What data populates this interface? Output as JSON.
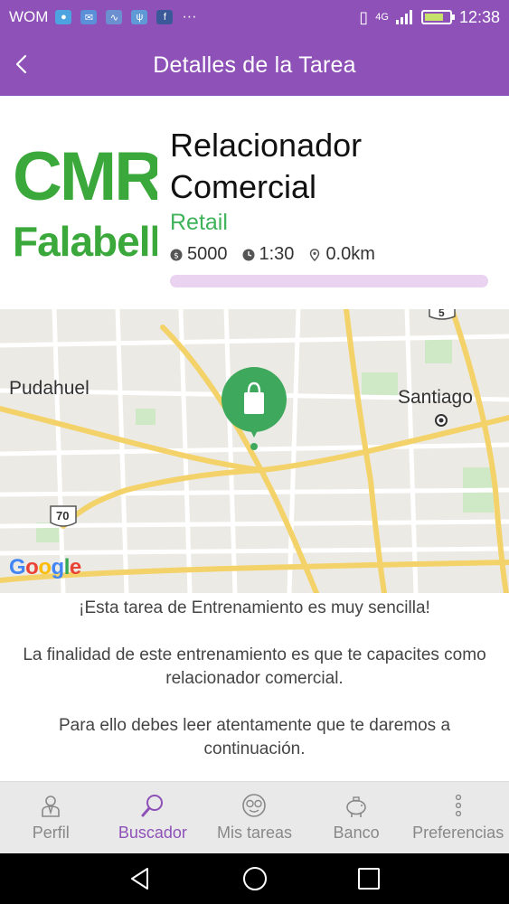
{
  "status_bar": {
    "carrier": "WOM",
    "network": "4G",
    "time": "12:38",
    "battery_level": 0.7
  },
  "header": {
    "title": "Detalles de la Tarea"
  },
  "task": {
    "logo_text_top": "CMR",
    "logo_text_bottom": "Falabella",
    "title": "Relacionador Comercial",
    "category": "Retail",
    "reward": "5000",
    "duration": "1:30",
    "distance": "0.0km",
    "progress": 0
  },
  "map": {
    "label_pudahuel": "Pudahuel",
    "label_santiago": "Santiago",
    "route_70": "70",
    "route_5": "5",
    "google_letters": [
      "G",
      "o",
      "o",
      "g",
      "l",
      "e"
    ],
    "marker_icon": "shopping-bag-icon"
  },
  "description": {
    "p1": "¡Esta tarea de Entrenamiento es muy sencilla!",
    "p2": "La finalidad de este entrenamiento es que te capacites como relacionador comercial.",
    "p3": "Para ello debes leer atentamente que te daremos a continuación."
  },
  "tabs": [
    {
      "label": "Perfil",
      "icon": "profile-icon"
    },
    {
      "label": "Buscador",
      "icon": "search-icon",
      "active": true
    },
    {
      "label": "Mis tareas",
      "icon": "tasks-icon"
    },
    {
      "label": "Banco",
      "icon": "piggy-bank-icon"
    },
    {
      "label": "Preferencias",
      "icon": "more-vertical-icon"
    }
  ],
  "colors": {
    "brand_purple": "#8E51B8",
    "accent_green": "#3fb35a",
    "progress_track": "#e9d3f1"
  }
}
